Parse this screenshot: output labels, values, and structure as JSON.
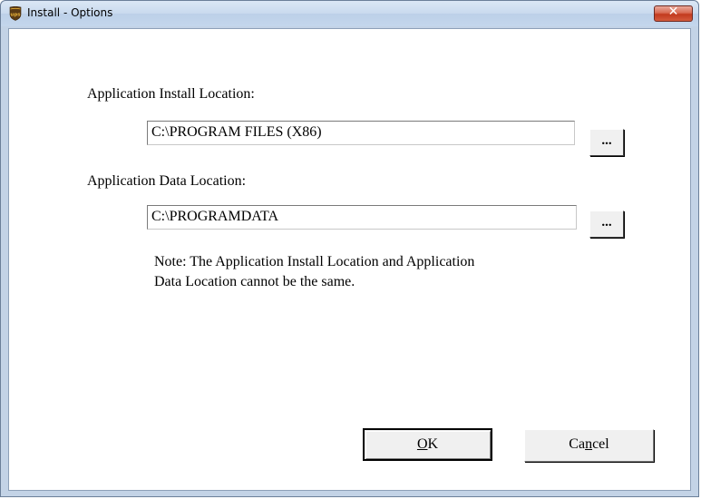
{
  "window": {
    "title": "Install - Options",
    "app_icon_text": "ups",
    "close_symbol": "✕"
  },
  "form": {
    "install_label": "Application Install Location:",
    "install_value": "C:\\PROGRAM FILES (X86)",
    "install_browse": "...",
    "data_label": "Application Data Location:",
    "data_value": "C:\\PROGRAMDATA",
    "data_browse": "...",
    "note_line1": "Note: The Application Install Location and Application",
    "note_line2": "Data Location cannot be the same."
  },
  "buttons": {
    "ok_accel": "O",
    "ok_rest": "K",
    "cancel_pre": "Ca",
    "cancel_accel": "n",
    "cancel_post": "cel"
  },
  "colors": {
    "titlebar": "#c9daee",
    "close_button": "#c23a1e",
    "app_icon": "#5a3a14"
  }
}
